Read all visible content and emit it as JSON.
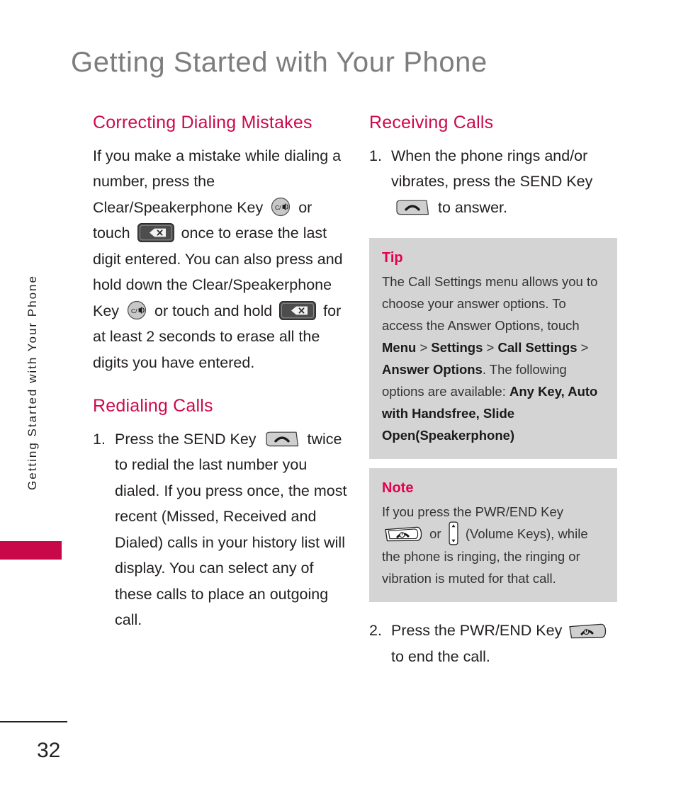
{
  "page": {
    "title": "Getting Started with Your Phone",
    "side_tab_label": "Getting Started with Your Phone",
    "page_number": "32",
    "accent_color": "#cc0a4e",
    "callout_accent_color": "#e6004c",
    "title_color": "#7d7d7d",
    "callout_bg_color": "#d4d4d4",
    "tab_marker_color": "#c9084a"
  },
  "left_column": {
    "heading_1": "Correcting Dialing Mistakes",
    "paragraph_1": {
      "part_1": "If you make a mistake while dialing a number, press the Clear/Speakerphone Key",
      "part_2": "or touch",
      "part_3": "once to erase the last digit entered. You can also press and hold down the Clear/Speakerphone Key",
      "part_4": "or touch and hold",
      "part_5": "for at least 2 seconds to erase all the digits you have entered."
    },
    "heading_2": "Redialing Calls",
    "step_1": {
      "number": "1.",
      "part_1": "Press the SEND Key",
      "part_2": "twice to redial the last number you dialed. If you press once, the most recent (Missed, Received and Dialed) calls in your history list will display. You can select any of these calls to place an outgoing call."
    }
  },
  "right_column": {
    "heading_1": "Receiving Calls",
    "step_1": {
      "number": "1.",
      "part_1": "When the phone rings and/or vibrates, press the SEND Key",
      "part_2": "to answer."
    },
    "tip": {
      "title": "Tip",
      "text_1": "The Call Settings menu allows you to choose your answer options. To access the Answer Options, touch ",
      "bold_1": "Menu",
      "sep_1": " > ",
      "bold_2": "Settings",
      "sep_2": " > ",
      "bold_3": "Call Settings",
      "sep_3": " > ",
      "bold_4": "Answer Options",
      "text_2": ". The following options are available: ",
      "bold_5": "Any Key, Auto with Handsfree, Slide Open(Speakerphone)"
    },
    "note": {
      "title": "Note",
      "text_1": "If you press the PWR/END Key",
      "text_2": "or",
      "text_3": "(Volume Keys), while the phone is ringing, the ringing or vibration is muted for that call."
    },
    "step_2": {
      "number": "2.",
      "part_1": "Press the PWR/END Key",
      "part_2": "to end the call."
    }
  },
  "icons": {
    "clear_speakerphone": "clear-speakerphone-key-icon",
    "backspace": "touch-backspace-key-icon",
    "send": "send-key-icon",
    "power_end": "power-end-key-icon",
    "volume": "volume-keys-icon"
  }
}
